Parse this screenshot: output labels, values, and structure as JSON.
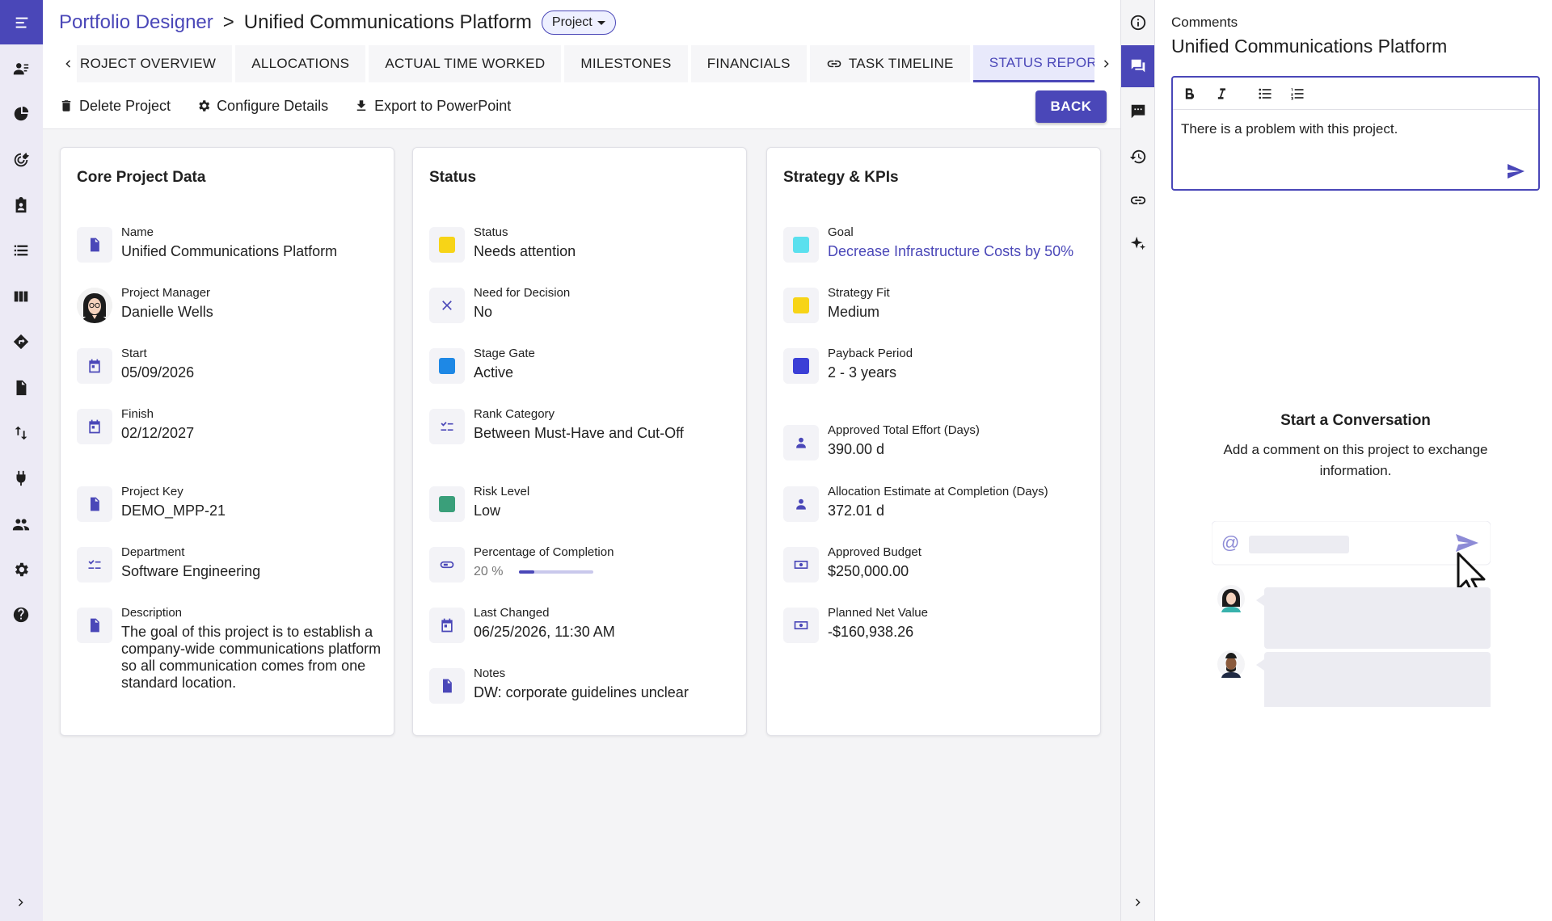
{
  "colors": {
    "accent": "#4a47b8",
    "status_yellow": "#f7d417",
    "stage_blue": "#1e88e5",
    "risk_green": "#3a9f7a",
    "goal_cyan": "#5be0ee",
    "payback_blue": "#3b3fd6"
  },
  "nav": {
    "items": [
      "menu-icon",
      "resource-icon",
      "portfolio-icon",
      "target-icon",
      "assignment-icon",
      "list-icon",
      "board-icon",
      "roadmap-icon",
      "document-icon",
      "swap-icon",
      "plugin-icon",
      "people-icon",
      "settings-icon",
      "help-icon"
    ]
  },
  "header": {
    "breadcrumb_root": "Portfolio Designer",
    "breadcrumb_sep": ">",
    "breadcrumb_current": "Unified Communications Platform",
    "type_chip": "Project"
  },
  "tabs": [
    {
      "label": "ROJECT OVERVIEW"
    },
    {
      "label": "ALLOCATIONS"
    },
    {
      "label": "ACTUAL TIME WORKED"
    },
    {
      "label": "MILESTONES"
    },
    {
      "label": "FINANCIALS"
    },
    {
      "label": "TASK TIMELINE"
    },
    {
      "label": "STATUS REPOR"
    }
  ],
  "toolbar": {
    "delete_label": "Delete Project",
    "configure_label": "Configure Details",
    "export_label": "Export to PowerPoint",
    "back_label": "BACK"
  },
  "core": {
    "title": "Core Project Data",
    "name_label": "Name",
    "name_value": "Unified Communications Platform",
    "pm_label": "Project Manager",
    "pm_value": "Danielle Wells",
    "start_label": "Start",
    "start_value": "05/09/2026",
    "finish_label": "Finish",
    "finish_value": "02/12/2027",
    "key_label": "Project Key",
    "key_value": "DEMO_MPP-21",
    "dept_label": "Department",
    "dept_value": "Software Engineering",
    "desc_label": "Description",
    "desc_value": "The goal of this project is to establish a company-wide communications platform so all communication comes from one standard location."
  },
  "status": {
    "title": "Status",
    "status_label": "Status",
    "status_value": "Needs attention",
    "decision_label": "Need for Decision",
    "decision_value": "No",
    "stage_label": "Stage Gate",
    "stage_value": "Active",
    "rank_label": "Rank Category",
    "rank_value": "Between Must-Have and Cut-Off",
    "risk_label": "Risk Level",
    "risk_value": "Low",
    "pct_label": "Percentage of Completion",
    "pct_value": "20 %",
    "pct_fraction": 0.2,
    "changed_label": "Last Changed",
    "changed_value": "06/25/2026, 11:30 AM",
    "notes_label": "Notes",
    "notes_value": "DW: corporate guidelines unclear"
  },
  "strategy": {
    "title": "Strategy & KPIs",
    "goal_label": "Goal",
    "goal_value": "Decrease Infrastructure Costs by 50%",
    "fit_label": "Strategy Fit",
    "fit_value": "Medium",
    "payback_label": "Payback Period",
    "payback_value": "2 - 3 years",
    "effort_label": "Approved Total Effort (Days)",
    "effort_value": "390.00 d",
    "alloc_label": "Allocation Estimate at Completion (Days)",
    "alloc_value": "372.01 d",
    "budget_label": "Approved Budget",
    "budget_value": "$250,000.00",
    "npv_label": "Planned Net Value",
    "npv_value": "-$160,938.26"
  },
  "right_rail": [
    "info-icon",
    "comments-icon",
    "feedback-icon",
    "history-icon",
    "link-icon",
    "sparkle-icon"
  ],
  "comments": {
    "label": "Comments",
    "title": "Unified Communications Platform",
    "editor_text": "There is a problem with this project.",
    "empty_title": "Start a Conversation",
    "empty_desc": "Add a comment on this project to exchange information.",
    "at_symbol": "@"
  }
}
